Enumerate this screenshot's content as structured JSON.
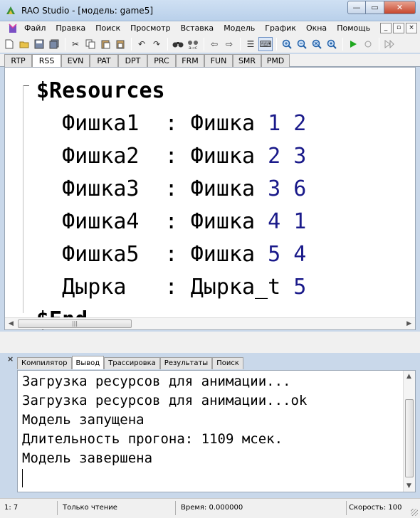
{
  "window": {
    "title": "RAO Studio - [модель: game5]",
    "controls": {
      "minimize": "—",
      "maximize": "▭",
      "close": "✕"
    }
  },
  "menu": {
    "items": [
      "Файл",
      "Правка",
      "Поиск",
      "Просмотр",
      "Вставка",
      "Модель",
      "График",
      "Окна",
      "Помощь"
    ],
    "mdi": {
      "minimize": "_",
      "restore": "▫",
      "close": "×"
    }
  },
  "toolbar": {
    "icons": [
      "new-file-icon",
      "open-folder-icon",
      "save-icon",
      "save-all-icon",
      "cut-icon",
      "copy-icon",
      "paste-icon",
      "paste-special-icon",
      "undo-icon",
      "redo-icon",
      "find-icon",
      "replace-icon",
      "back-icon",
      "forward-icon",
      "list-icon",
      "keyboard-icon",
      "zoom-in-icon",
      "zoom-out-icon",
      "zoom-reset-icon",
      "zoom-fit-icon",
      "run-icon",
      "stop-icon",
      "skip-icon"
    ]
  },
  "editor_tabs": [
    "RTP",
    "RSS",
    "EVN",
    "PAT",
    "DPT",
    "PRC",
    "FRM",
    "FUN",
    "SMR",
    "PMD"
  ],
  "editor_selected_tab": "RSS",
  "code": {
    "header": "$Resources",
    "footer": "$End",
    "rows": [
      {
        "name": "Фишка1",
        "type": "Фишка",
        "values": "1 2"
      },
      {
        "name": "Фишка2",
        "type": "Фишка",
        "values": "2 3"
      },
      {
        "name": "Фишка3",
        "type": "Фишка",
        "values": "3 6"
      },
      {
        "name": "Фишка4",
        "type": "Фишка",
        "values": "4 1"
      },
      {
        "name": "Фишка5",
        "type": "Фишка",
        "values": "5 4"
      },
      {
        "name": "Дырка",
        "type": "Дырка_t",
        "values": "5"
      }
    ]
  },
  "output_tabs": [
    "Компилятор",
    "Вывод",
    "Трассировка",
    "Результаты",
    "Поиск"
  ],
  "output_selected_tab": "Вывод",
  "output_lines": [
    "Загрузка ресурсов для анимации...",
    "Загрузка ресурсов для анимации...ok",
    "Модель запущена",
    "Длительность прогона: 1109 мсек.",
    "Модель завершена"
  ],
  "status": {
    "position": "1: 7",
    "mode": "Только чтение",
    "time": "Время: 0.000000",
    "speed": "Скорость: 100"
  },
  "colors": {
    "number": "#1a1a8a",
    "accent": "#6b8fc4"
  }
}
